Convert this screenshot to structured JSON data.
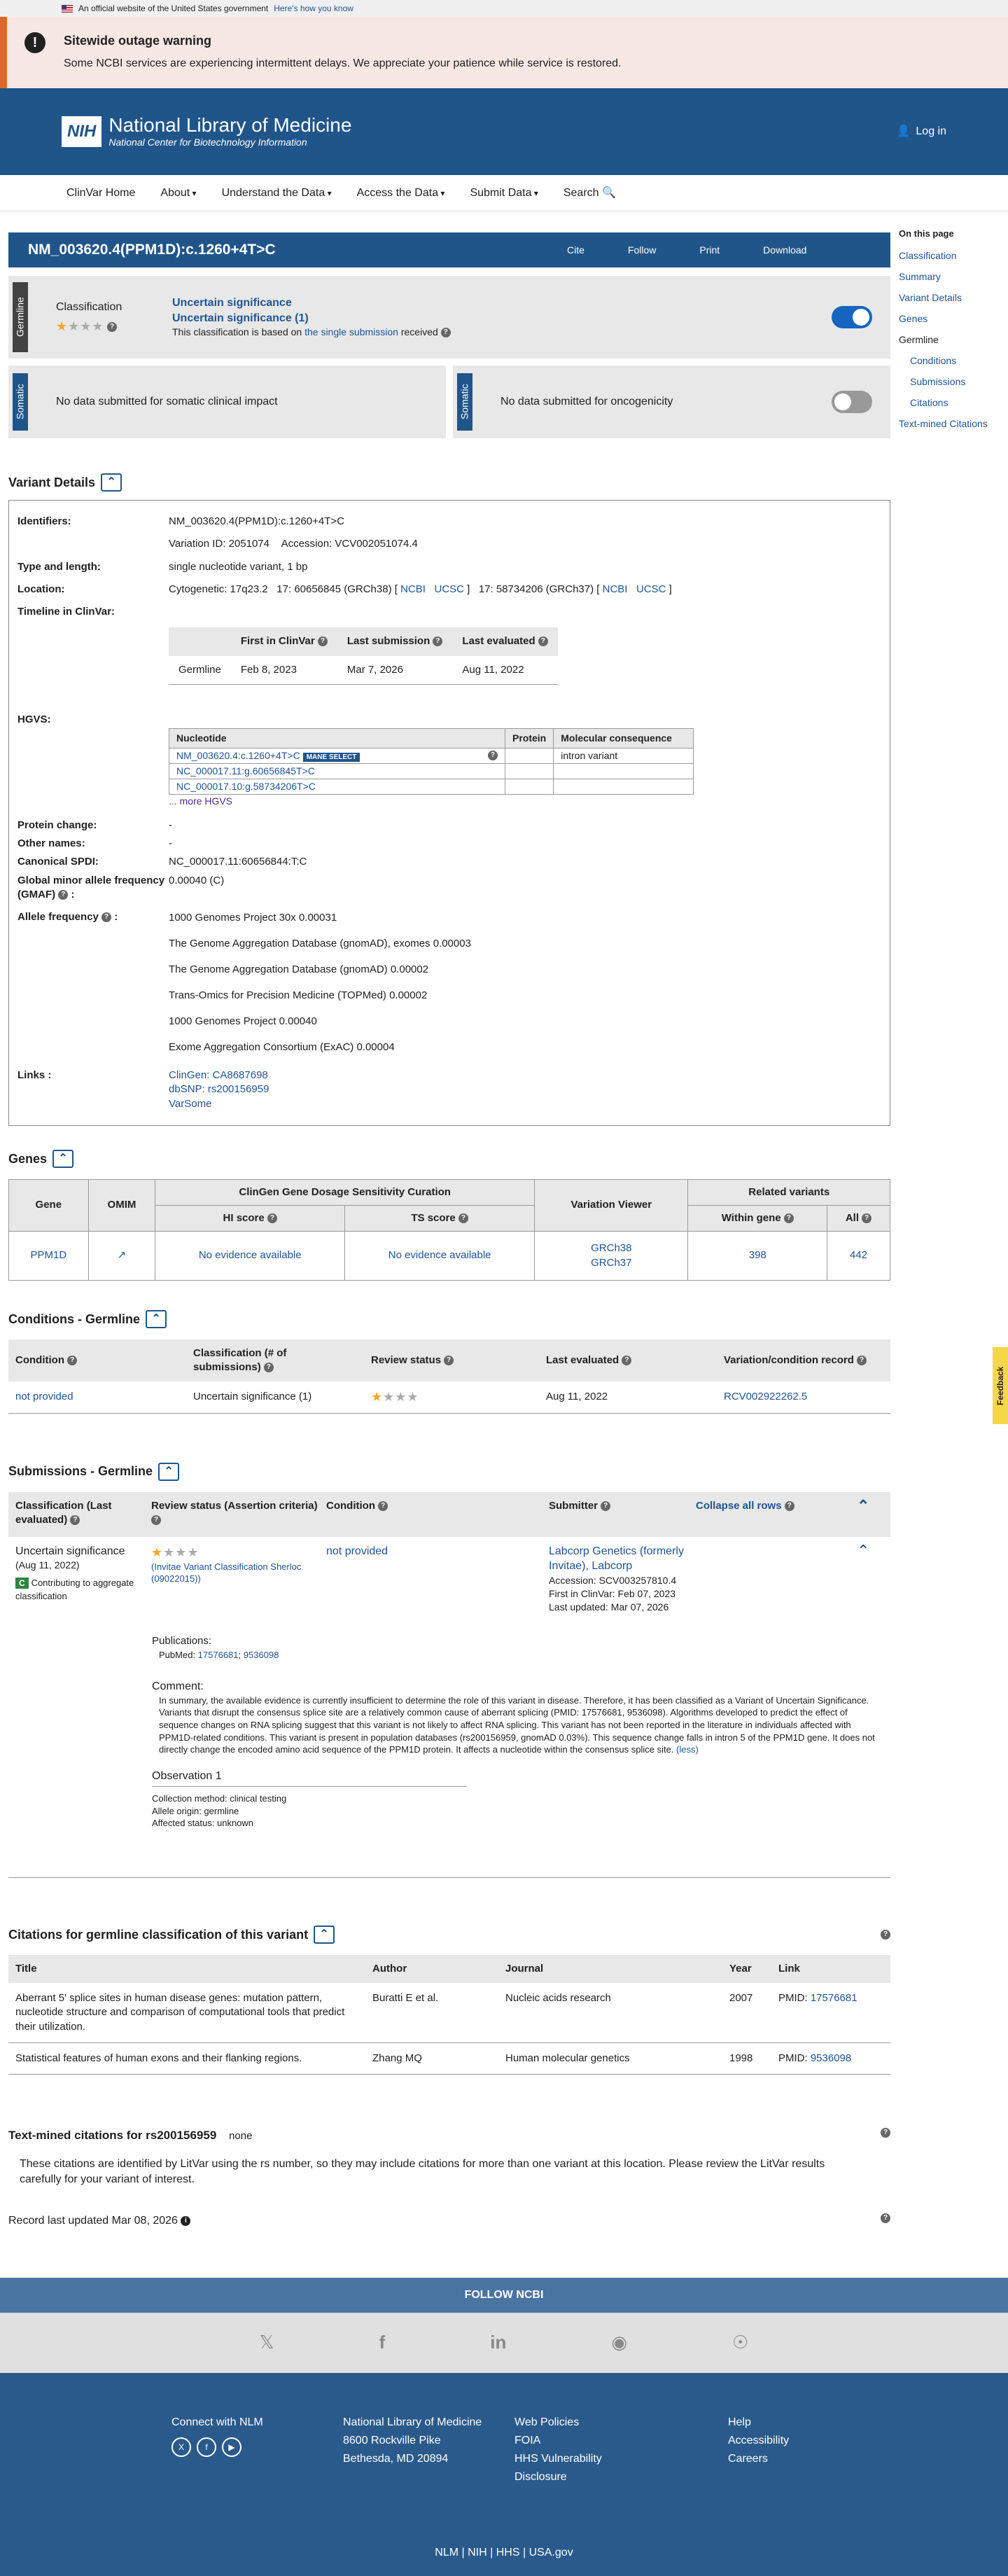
{
  "gov_banner": {
    "text": "An official website of the United States government",
    "link": "Here's how you know"
  },
  "outage": {
    "title": "Sitewide outage warning",
    "message": "Some NCBI services are experiencing intermittent delays. We appreciate your patience while service is restored."
  },
  "header": {
    "logo_abbr": "NIH",
    "title": "National Library of Medicine",
    "subtitle": "National Center for Biotechnology Information",
    "login": "Log in"
  },
  "nav": {
    "items": [
      "ClinVar Home",
      "About",
      "Understand the Data",
      "Access the Data",
      "Submit Data",
      "Search"
    ]
  },
  "title_bar": {
    "title": "NM_003620.4(PPM1D):c.1260+4T>C",
    "actions": [
      "Cite",
      "Follow",
      "Print",
      "Download"
    ]
  },
  "sidebar": {
    "heading": "On this page",
    "items": [
      "Classification Summary",
      "Variant Details",
      "Genes",
      "Germline",
      "Conditions",
      "Submissions",
      "Citations",
      "Text-mined Citations"
    ]
  },
  "germline": {
    "tag": "Germline",
    "label": "Classification",
    "class1": "Uncertain significance",
    "class2": "Uncertain significance (1)",
    "basis_prefix": "This classification is based on",
    "basis_link": "the single submission",
    "basis_suffix": "received"
  },
  "somatic": {
    "tag1": "Somatic",
    "msg1": "No data submitted for somatic clinical impact",
    "tag2": "Somatic",
    "msg2": "No data submitted for oncogenicity"
  },
  "variant_details": {
    "title": "Variant Details",
    "identifiers_label": "Identifiers:",
    "identifiers": "NM_003620.4(PPM1D):c.1260+4T>C",
    "variation_id": "Variation ID: 2051074",
    "accession": "Accession: VCV002051074.4",
    "type_label": "Type and length:",
    "type": "single nucleotide variant, 1 bp",
    "location_label": "Location:",
    "cyto": "Cytogenetic: 17q23.2",
    "loc38": "17: 60656845 (GRCh38)",
    "loc37": "17: 58734206 (GRCh37)",
    "ncbi": "NCBI",
    "ucsc": "UCSC",
    "timeline_label": "Timeline in ClinVar:",
    "timeline_headers": [
      "",
      "First in ClinVar",
      "Last submission",
      "Last evaluated"
    ],
    "timeline_row": [
      "Germline",
      "Feb 8, 2023",
      "Mar 7, 2026",
      "Aug 11, 2022"
    ],
    "hgvs_label": "HGVS:",
    "hgvs_headers": [
      "Nucleotide",
      "Protein",
      "Molecular consequence"
    ],
    "hgvs_rows": [
      [
        "NM_003620.4:c.1260+4T>C",
        "",
        "intron variant"
      ],
      [
        "NC_000017.11:g.60656845T>C",
        "",
        ""
      ],
      [
        "NC_000017.10:g.58734206T>C",
        "",
        ""
      ]
    ],
    "mane": "MANE SELECT",
    "more_hgvs": "... more HGVS",
    "protein_change_label": "Protein change:",
    "protein_change": "-",
    "other_names_label": "Other names:",
    "other_names": "-",
    "spdi_label": "Canonical SPDI:",
    "spdi": "NC_000017.11:60656844:T:C",
    "gmaf_label": "Global minor allele frequency (GMAF)",
    "gmaf": "0.00040 (C)",
    "af_label": "Allele frequency",
    "af": [
      "1000 Genomes Project 30x 0.00031",
      "The Genome Aggregation Database (gnomAD), exomes 0.00003",
      "The Genome Aggregation Database (gnomAD) 0.00002",
      "Trans-Omics for Precision Medicine (TOPMed) 0.00002",
      "1000 Genomes Project 0.00040",
      "Exome Aggregation Consortium (ExAC) 0.00004"
    ],
    "links_label": "Links :",
    "links": [
      "ClinGen: CA8687698",
      "dbSNP: rs200156959",
      "VarSome"
    ]
  },
  "genes": {
    "title": "Genes",
    "h_gene": "Gene",
    "h_omim": "OMIM",
    "h_clingen": "ClinGen Gene Dosage Sensitivity Curation",
    "h_hi": "HI score",
    "h_ts": "TS score",
    "h_viewer": "Variation Viewer",
    "h_related": "Related variants",
    "h_within": "Within gene",
    "h_all": "All",
    "gene": "PPM1D",
    "hi": "No evidence available",
    "ts": "No evidence available",
    "v38": "GRCh38",
    "v37": "GRCh37",
    "within": "398",
    "all": "442"
  },
  "conditions": {
    "title": "Conditions - Germline",
    "headers": [
      "Condition",
      "Classification (# of submissions)",
      "Review status",
      "Last evaluated",
      "Variation/condition record"
    ],
    "row": [
      "not provided",
      "Uncertain significance (1)",
      "",
      "Aug 11, 2022",
      "RCV002922262.5"
    ]
  },
  "submissions": {
    "title": "Submissions - Germline",
    "h_class": "Classification (Last evaluated)",
    "h_review": "Review status (Assertion criteria)",
    "h_cond": "Condition",
    "h_submitter": "Submitter",
    "collapse": "Collapse all rows",
    "classification": "Uncertain significance",
    "date": "(Aug 11, 2022)",
    "contrib_badge": "C",
    "contrib": "Contributing to aggregate classification",
    "criteria": "(Invitae Variant Classification Sherloc (09022015))",
    "condition": "not provided",
    "submitter": "Labcorp Genetics (formerly Invitae), Labcorp",
    "sub_accession": "Accession: SCV003257810.4",
    "first": "First in ClinVar: Feb 07, 2023",
    "updated": "Last updated: Mar 07, 2026",
    "pub_label": "Publications:",
    "pubmed_prefix": "PubMed:",
    "pubmed": [
      "17576681",
      "9536098"
    ],
    "comment_label": "Comment:",
    "comment": "In summary, the available evidence is currently insufficient to determine the role of this variant in disease. Therefore, it has been classified as a Variant of Uncertain Significance. Variants that disrupt the consensus splice site are a relatively common cause of aberrant splicing (PMID: 17576681, 9536098). Algorithms developed to predict the effect of sequence changes on RNA splicing suggest that this variant is not likely to affect RNA splicing. This variant has not been reported in the literature in individuals affected with PPM1D-related conditions. This variant is present in population databases (rs200156959, gnomAD 0.03%). This sequence change falls in intron 5 of the PPM1D gene. It does not directly change the encoded amino acid sequence of the PPM1D protein. It affects a nucleotide within the consensus splice site.",
    "less": "(less)",
    "obs": "Observation 1",
    "method": "Collection method: clinical testing",
    "origin": "Allele origin: germline",
    "affected": "Affected status: unknown"
  },
  "citations": {
    "title": "Citations for germline classification of this variant",
    "headers": [
      "Title",
      "Author",
      "Journal",
      "Year",
      "Link"
    ],
    "rows": [
      [
        "Aberrant 5' splice sites in human disease genes: mutation pattern, nucleotide structure and comparison of computational tools that predict their utilization.",
        "Buratti E et al.",
        "Nucleic acids research",
        "2007",
        "17576681"
      ],
      [
        "Statistical features of human exons and their flanking regions.",
        "Zhang MQ",
        "Human molecular genetics",
        "1998",
        "9536098"
      ]
    ],
    "pmid_prefix": "PMID:"
  },
  "textmined": {
    "title": "Text-mined citations for rs200156959",
    "none": "none",
    "note": "These citations are identified by LitVar using the rs number, so they may include citations for more than one variant at this location. Please review the LitVar results carefully for your variant of interest."
  },
  "record": {
    "updated": "Record last updated Mar 08, 2026"
  },
  "footer": {
    "follow": "FOLLOW NCBI",
    "social": [
      "X",
      "f",
      "in",
      "GH",
      "RSS"
    ],
    "connect": "Connect with NLM",
    "nlm_name": "National Library of Medicine",
    "addr1": "8600 Rockville Pike",
    "addr2": "Bethesda, MD 20894",
    "policies": [
      "Web Policies",
      "FOIA",
      "HHS Vulnerability Disclosure"
    ],
    "help": [
      "Help",
      "Accessibility",
      "Careers"
    ],
    "bottom": [
      "NLM",
      "NIH",
      "HHS",
      "USA.gov"
    ]
  },
  "feedback": "Feedback"
}
